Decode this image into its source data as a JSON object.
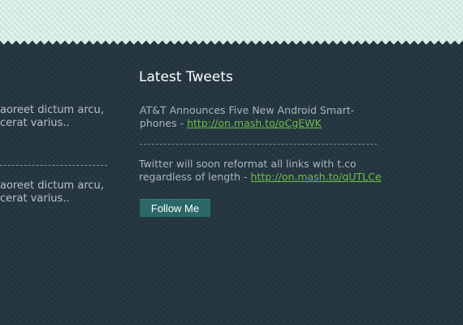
{
  "left_column": {
    "post_1": {
      "line_1": "aoreet dictum arcu,",
      "line_2": "cerat varius.."
    },
    "post_2": {
      "line_1": "aoreet dictum arcu,",
      "line_2": "cerat varius.."
    }
  },
  "tweets_widget": {
    "title": "Latest Tweets",
    "tweets": [
      {
        "line_1": "AT&T Announces Five New Android Smart-",
        "line_2_prefix": "phones - ",
        "link": "http://on.mash.to/oCgEWK"
      },
      {
        "line_1": "Twitter will soon reformat all links with t.co",
        "line_2_prefix": "regardless of length - ",
        "link": "http://on.mash.to/qUTLCe"
      }
    ],
    "follow_button_label": "Follow Me"
  },
  "colors": {
    "background": "#253641",
    "top_band": "#d4ebe5",
    "link": "#6cbf47",
    "button": "#2b6867"
  }
}
